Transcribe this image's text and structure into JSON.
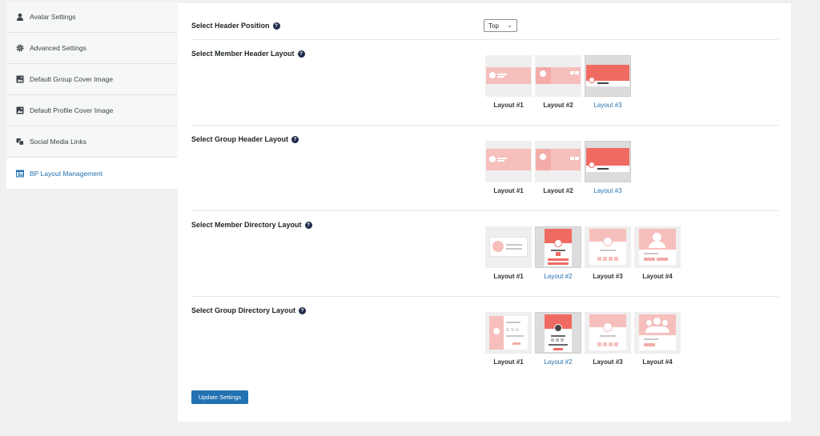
{
  "sidebar": {
    "items": [
      {
        "label": "Avatar Settings",
        "icon": "user-icon"
      },
      {
        "label": "Advanced Settings",
        "icon": "gear-icon"
      },
      {
        "label": "Default Group Cover Image",
        "icon": "image-icon"
      },
      {
        "label": "Default Profile Cover Image",
        "icon": "image-icon"
      },
      {
        "label": "Social Media Links",
        "icon": "share-icon"
      },
      {
        "label": "BP Layout Management",
        "icon": "layout-icon",
        "active": true
      }
    ]
  },
  "settings": {
    "header_position": {
      "label": "Select Header Position",
      "help": "?",
      "value": "Top"
    },
    "member_header": {
      "label": "Select Member Header Layout",
      "help": "?",
      "options": [
        "Layout #1",
        "Layout #2",
        "Layout #3"
      ],
      "selected": "Layout #3"
    },
    "group_header": {
      "label": "Select Group Header Layout",
      "help": "?",
      "options": [
        "Layout #1",
        "Layout #2",
        "Layout #3"
      ],
      "selected": "Layout #3"
    },
    "member_directory": {
      "label": "Select Member Directory Layout",
      "help": "?",
      "options": [
        "Layout #1",
        "Layout #2",
        "Layout #3",
        "Layout #4"
      ],
      "selected": "Layout #2"
    },
    "group_directory": {
      "label": "Select Group Directory Layout",
      "help": "?",
      "options": [
        "Layout #1",
        "Layout #2",
        "Layout #3",
        "Layout #4"
      ],
      "selected": "Layout #2"
    }
  },
  "update_button": "Update Settings",
  "colors": {
    "accent": "#2271b1",
    "thumb_red": "#ef6b62",
    "thumb_pink": "#f6bfbc"
  }
}
